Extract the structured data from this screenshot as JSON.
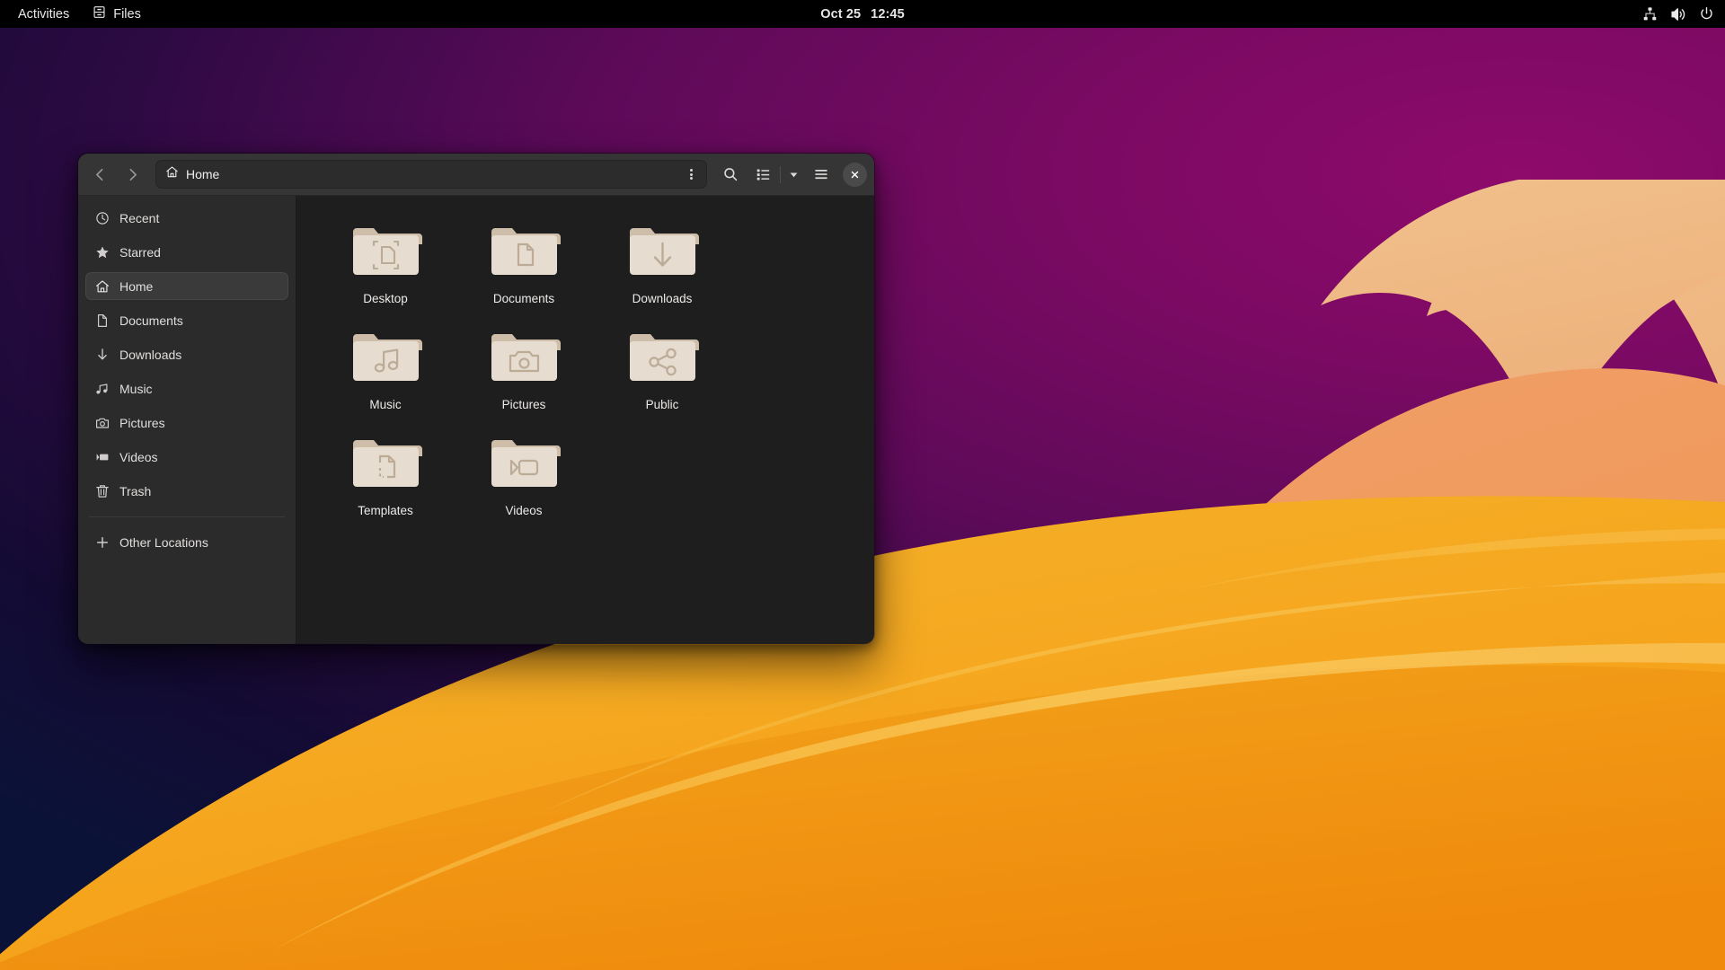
{
  "topbar": {
    "activities": "Activities",
    "app_name": "Files",
    "app_icon": "files-icon",
    "clock_date": "Oct 25",
    "clock_time": "12:45",
    "status_icons": [
      "network-wired-icon",
      "volume-icon",
      "power-icon"
    ]
  },
  "window": {
    "title": "Home",
    "pathbar": {
      "icon": "home-icon",
      "label": "Home",
      "menu_icon": "vertical-dots-icon"
    },
    "buttons": {
      "back": "back-icon",
      "forward": "forward-icon",
      "search": "search-icon",
      "view_toggle": "list-view-icon",
      "view_dropdown": "chevron-down-icon",
      "menu": "hamburger-menu-icon",
      "close": "×"
    }
  },
  "sidebar": {
    "items": [
      {
        "label": "Recent",
        "icon": "clock-icon",
        "selected": false
      },
      {
        "label": "Starred",
        "icon": "star-icon",
        "selected": false
      },
      {
        "label": "Home",
        "icon": "home-icon",
        "selected": true
      },
      {
        "label": "Documents",
        "icon": "document-icon",
        "selected": false
      },
      {
        "label": "Downloads",
        "icon": "download-icon",
        "selected": false
      },
      {
        "label": "Music",
        "icon": "music-icon",
        "selected": false
      },
      {
        "label": "Pictures",
        "icon": "camera-icon",
        "selected": false
      },
      {
        "label": "Videos",
        "icon": "video-icon",
        "selected": false
      },
      {
        "label": "Trash",
        "icon": "trash-icon",
        "selected": false
      }
    ],
    "other_locations": {
      "label": "Other Locations",
      "icon": "plus-icon"
    }
  },
  "files": [
    {
      "name": "Desktop",
      "emblem": "desktop-emblem"
    },
    {
      "name": "Documents",
      "emblem": "document-emblem"
    },
    {
      "name": "Downloads",
      "emblem": "download-emblem"
    },
    {
      "name": "Music",
      "emblem": "music-emblem"
    },
    {
      "name": "Pictures",
      "emblem": "camera-emblem"
    },
    {
      "name": "Public",
      "emblem": "share-emblem"
    },
    {
      "name": "Templates",
      "emblem": "template-emblem"
    },
    {
      "name": "Videos",
      "emblem": "video-emblem"
    }
  ],
  "colors": {
    "topbar_bg": "#000000",
    "headerbar_bg": "#353535",
    "sidebar_bg": "#2b2b2b",
    "content_bg": "#1e1e1e",
    "selection_bg": "#3a3a3a",
    "folder_face": "#e6dccf",
    "folder_tab": "#cdbda9",
    "folder_emblem": "#bcab97",
    "wallpaper_purple": "#8d0868",
    "wallpaper_navy": "#0c1438",
    "wallpaper_orange": "#f4a01c"
  }
}
